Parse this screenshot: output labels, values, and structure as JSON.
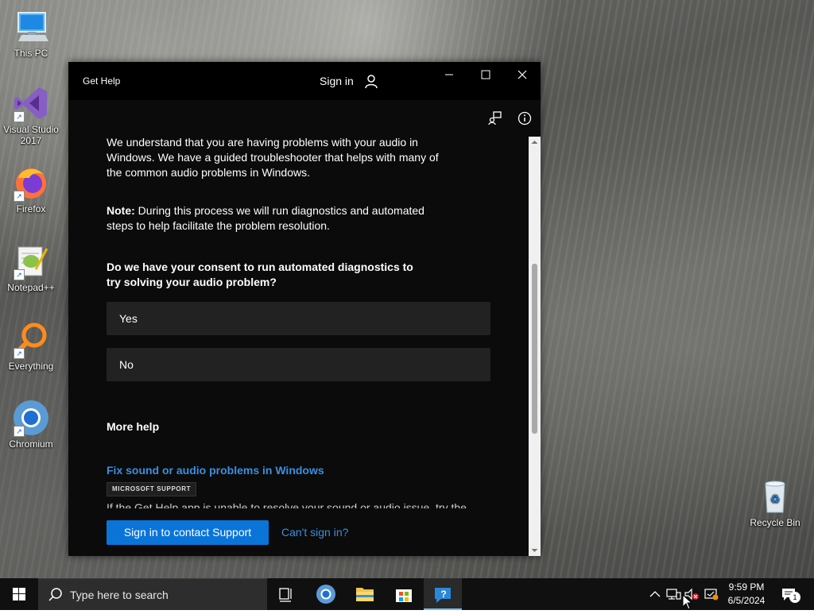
{
  "desktop": {
    "icons": [
      {
        "label": "This PC"
      },
      {
        "label": "Visual Studio 2017"
      },
      {
        "label": "Firefox"
      },
      {
        "label": "Notepad++"
      },
      {
        "label": "Everything"
      },
      {
        "label": "Chromium"
      },
      {
        "label": "Recycle Bin"
      }
    ]
  },
  "window": {
    "title": "Get Help",
    "signin": "Sign in",
    "content": {
      "p1": "We understand that you are having problems with your audio in Windows. We have a guided troubleshooter that helps with many of the common audio problems in Windows.",
      "p2_bold": "Note:",
      "p2_rest": " During this process we will run diagnostics and automated steps to help facilitate the problem resolution.",
      "question": "Do we have your consent to run automated diagnostics to try solving your audio problem?",
      "choices": [
        "Yes",
        "No"
      ],
      "more_help": "More help",
      "link": "Fix sound or audio problems in Windows",
      "badge": "MICROSOFT SUPPORT",
      "cut_text": "If the Get Help app is unable to resolve your sound or audio issue, try the"
    },
    "footer": {
      "primary": "Sign in to contact Support",
      "secondary": "Can't sign in?"
    }
  },
  "taskbar": {
    "search_placeholder": "Type here to search",
    "time": "9:59 PM",
    "date": "6/5/2024",
    "notification_count": "1"
  },
  "colors": {
    "accent": "#0a74d8",
    "link": "#3a8fe0",
    "window_bg": "#0b0b0b",
    "choice_bg": "#222222"
  }
}
